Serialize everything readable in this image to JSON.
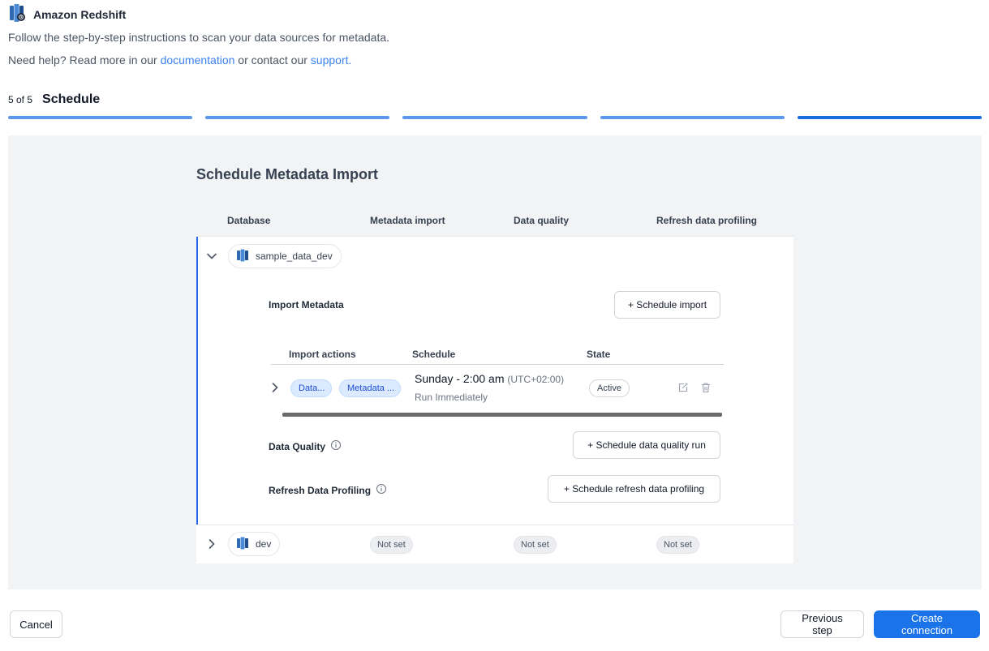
{
  "header": {
    "title": "Amazon Redshift",
    "intro": "Follow the step-by-step instructions to scan your data sources for metadata.",
    "help_prefix": "Need help? Read more in our ",
    "help_doc_link": "documentation",
    "help_middle": " or contact our ",
    "help_support_link": "support."
  },
  "step": {
    "count": "5 of 5",
    "title": "Schedule",
    "total": 5,
    "current": 5
  },
  "colors": {
    "accent": "#1a73e8",
    "progress": "#5b97ea",
    "expanded_border": "#2563eb"
  },
  "section": {
    "title": "Schedule Metadata Import"
  },
  "columns": [
    "Database",
    "Metadata import",
    "Data quality",
    "Refresh data profiling"
  ],
  "databases": [
    {
      "name": "sample_data_dev",
      "icon": "redshift-icon",
      "expanded": true,
      "import_metadata": {
        "label": "Import Metadata",
        "button": "+ Schedule import",
        "table_headers": [
          "Import actions",
          "Schedule",
          "State"
        ],
        "rows": [
          {
            "tags": [
              "Data...",
              "Metadata ..."
            ],
            "schedule": "Sunday - 2:00 am",
            "timezone": "(UTC+02:00)",
            "sub": "Run Immediately",
            "state": "Active",
            "actions": [
              "edit-icon",
              "trash-icon"
            ]
          }
        ]
      },
      "data_quality": {
        "label": "Data Quality",
        "button": "+ Schedule data quality run",
        "icon": "info-icon"
      },
      "refresh_profiling": {
        "label": "Refresh Data Profiling",
        "button": "+ Schedule refresh data profiling",
        "icon": "info-icon"
      }
    },
    {
      "name": "dev",
      "icon": "redshift-icon",
      "expanded": false,
      "metadata_import": "Not set",
      "data_quality": "Not set",
      "refresh_profiling": "Not set"
    }
  ],
  "footer": {
    "cancel": "Cancel",
    "previous": "Previous step",
    "create": "Create connection"
  }
}
